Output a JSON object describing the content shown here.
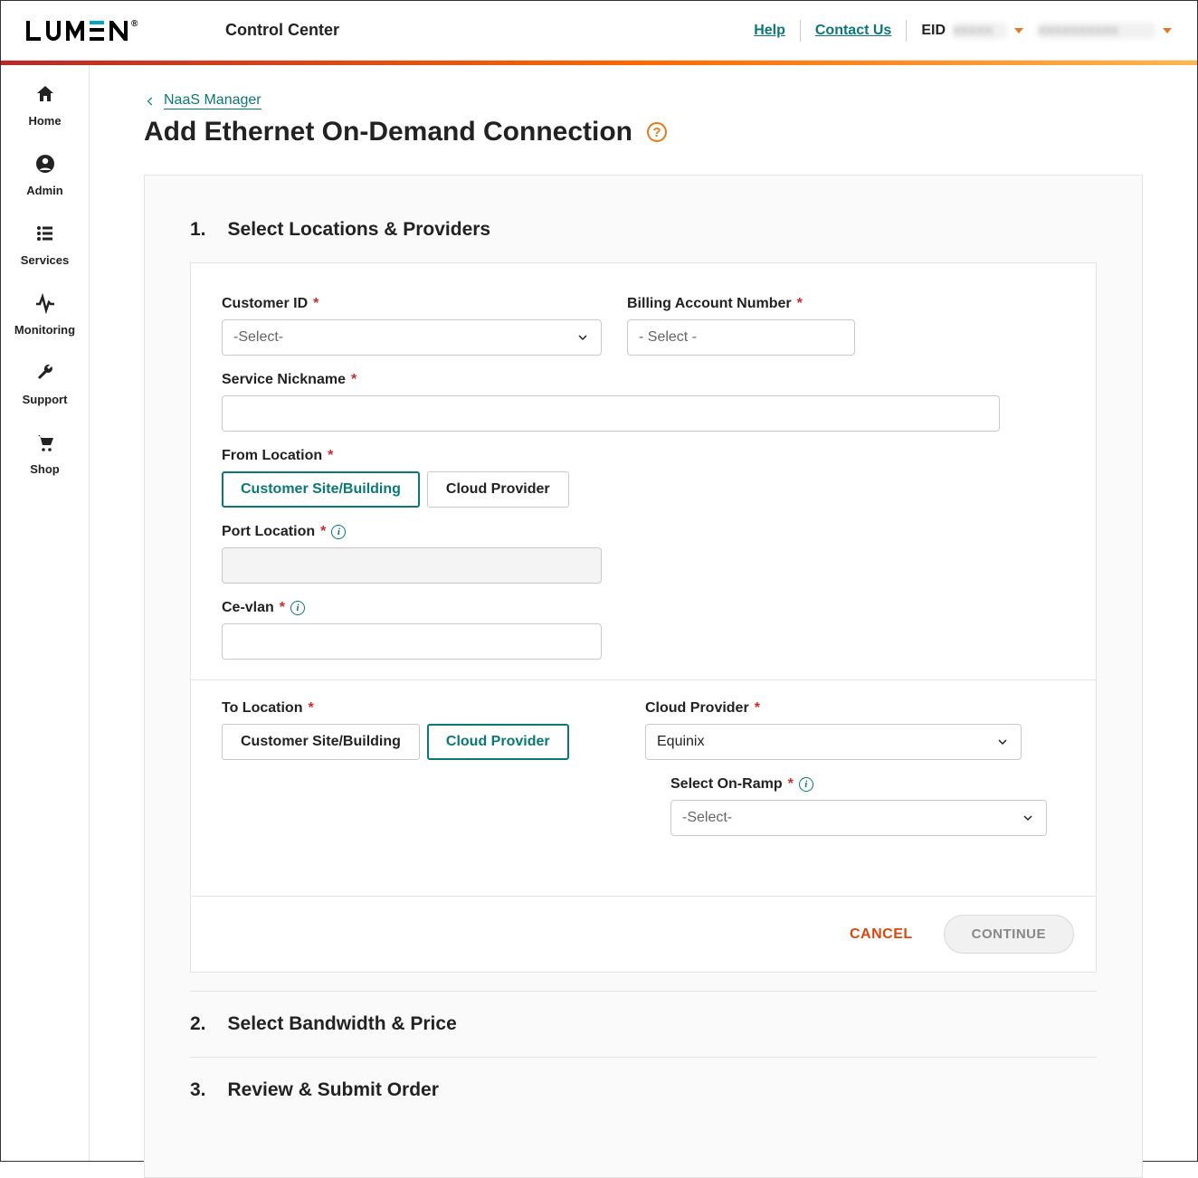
{
  "topbar": {
    "brand": "LUMEN",
    "app_title": "Control Center",
    "help_label": "Help",
    "contact_label": "Contact Us",
    "eid_prefix": "EID"
  },
  "sidebar": {
    "items": [
      {
        "label": "Home",
        "icon": "home"
      },
      {
        "label": "Admin",
        "icon": "user"
      },
      {
        "label": "Services",
        "icon": "list"
      },
      {
        "label": "Monitoring",
        "icon": "activity"
      },
      {
        "label": "Support",
        "icon": "wrench"
      },
      {
        "label": "Shop",
        "icon": "cart"
      }
    ]
  },
  "breadcrumb": {
    "back_label": "NaaS Manager"
  },
  "page": {
    "title": "Add Ethernet On-Demand Connection"
  },
  "steps": {
    "s1": {
      "num": "1.",
      "title": "Select Locations & Providers"
    },
    "s2": {
      "num": "2.",
      "title": "Select Bandwidth & Price"
    },
    "s3": {
      "num": "3.",
      "title": "Review & Submit Order"
    }
  },
  "form": {
    "customer_id": {
      "label": "Customer ID",
      "placeholder": "-Select-"
    },
    "ban": {
      "label": "Billing Account Number",
      "placeholder": "- Select -"
    },
    "nickname": {
      "label": "Service Nickname"
    },
    "from_location": {
      "label": "From Location",
      "opt_site": "Customer Site/Building",
      "opt_cloud": "Cloud Provider"
    },
    "port_location": {
      "label": "Port Location"
    },
    "ce_vlan": {
      "label": "Ce-vlan"
    },
    "to_location": {
      "label": "To Location",
      "opt_site": "Customer Site/Building",
      "opt_cloud": "Cloud Provider"
    },
    "cloud_provider": {
      "label": "Cloud Provider",
      "value": "Equinix"
    },
    "on_ramp": {
      "label": "Select On-Ramp",
      "placeholder": "-Select-"
    },
    "cancel_label": "CANCEL",
    "continue_label": "CONTINUE"
  }
}
